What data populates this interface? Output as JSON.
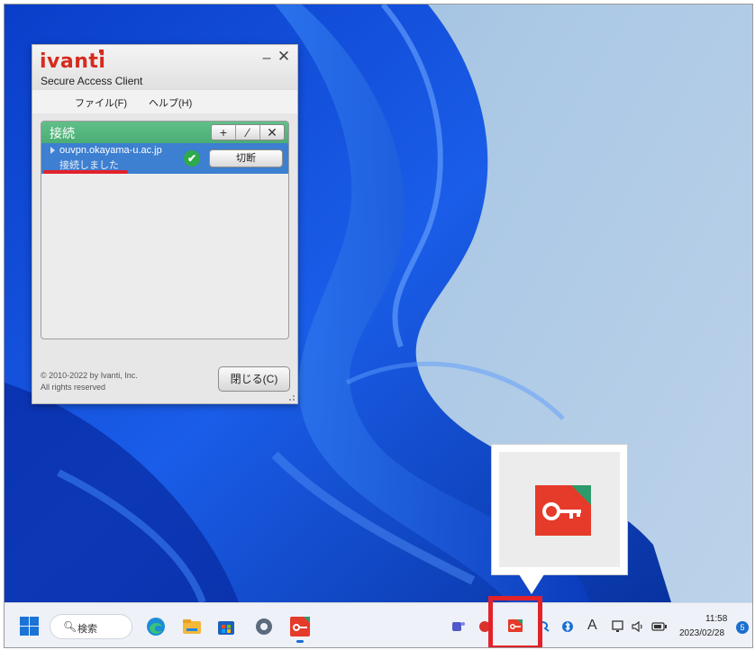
{
  "window": {
    "logo": "ivanti",
    "subtitle": "Secure Access Client",
    "minimize": "–",
    "close": "✕",
    "menu": [
      "ファイル(F)",
      "ヘルプ(H)"
    ],
    "panel_title": "接続",
    "toolbar": [
      "+",
      "⁄",
      "✕"
    ],
    "connection": {
      "host": "ouvpn.okayama-u.ac.jp",
      "status": "接続しました",
      "disconnect_label": "切断"
    },
    "copyright_line1": "© 2010-2022 by Ivanti, Inc.",
    "copyright_line2": "All rights reserved",
    "close_button": "閉じる(C)"
  },
  "taskbar": {
    "search_label": "検索",
    "time": "11:58",
    "date": "2023/02/28",
    "notification_count": "5",
    "ime_indicator": "A"
  },
  "colors": {
    "accent_green": "#4aae74",
    "selection_blue": "#3d7fd0",
    "ivanti_red": "#d52b1e",
    "highlight_red": "#e2222b"
  }
}
